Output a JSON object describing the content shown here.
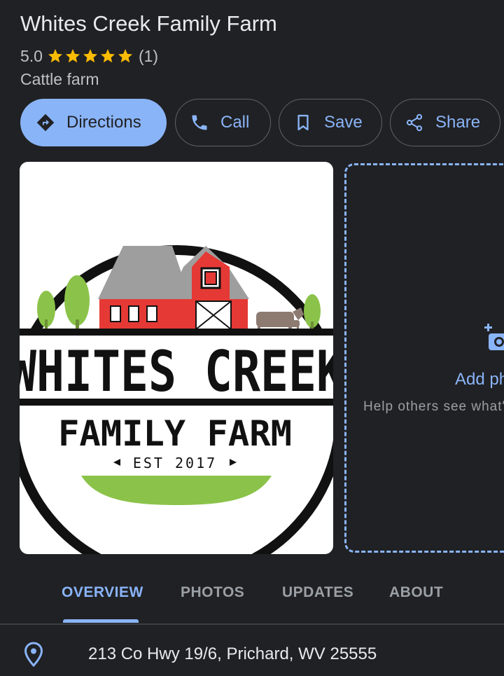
{
  "place": {
    "title": "Whites Creek Family Farm",
    "rating": "5.0",
    "stars": 5,
    "review_count": "(1)",
    "category": "Cattle farm"
  },
  "actions": {
    "directions": "Directions",
    "call": "Call",
    "save": "Save",
    "share": "Share"
  },
  "logo": {
    "line1": "WHITES CREEK",
    "line2": "FAMILY FARM",
    "est": "EST 2017"
  },
  "add_photo": {
    "title": "Add photos",
    "subtitle": "Help others see what's here"
  },
  "tabs": [
    "OVERVIEW",
    "PHOTOS",
    "UPDATES",
    "ABOUT"
  ],
  "address": "213 Co Hwy 19/6, Prichard, WV 25555",
  "colors": {
    "accent": "#8ab4f8",
    "star": "#fbbc04",
    "background": "#202124"
  }
}
